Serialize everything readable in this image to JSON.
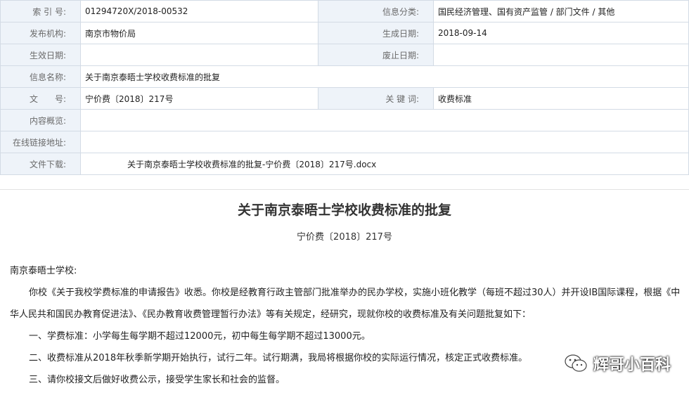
{
  "meta": {
    "index_label": "索 引 号:",
    "index_value": "01294720X/2018-00532",
    "category_label": "信息分类:",
    "category_value": "国民经济管理、国有资产监管 / 部门文件 / 其他",
    "publisher_label": "发布机构:",
    "publisher_value": "南京市物价局",
    "created_label": "生成日期:",
    "created_value": "2018-09-14",
    "effective_label": "生效日期:",
    "effective_value": "",
    "abolished_label": "废止日期:",
    "abolished_value": "",
    "name_label": "信息名称:",
    "name_value": "关于南京泰晤士学校收费标准的批复",
    "docno_label": "文　　号:",
    "docno_value": "宁价费〔2018〕217号",
    "keywords_label": "关 键 词:",
    "keywords_value": "收费标准",
    "summary_label": "内容概览:",
    "summary_value": "",
    "link_label": "在线链接地址:",
    "link_value": "",
    "download_label": "文件下载:",
    "download_value": "关于南京泰晤士学校收费标准的批复-宁价费〔2018〕217号.docx"
  },
  "document": {
    "title": "关于南京泰晤士学校收费标准的批复",
    "number": "宁价费〔2018〕217号",
    "salutation": "南京泰晤士学校:",
    "paragraph1": "你校《关于我校学费标准的申请报告》收悉。你校是经教育行政主管部门批准举办的民办学校，实施小班化教学（每班不超过30人）并开设IB国际课程，根据《中华人民共和国民办教育促进法》、《民办教育收费管理暂行办法》等有关规定，经研究，现就你校的收费标准及有关问题批复如下：",
    "item1": "一、学费标准：小学每生每学期不超过12000元，初中每生每学期不超过13000元。",
    "item2": "二、收费标准从2018年秋季新学期开始执行，试行二年。试行期满，我局将根据你校的实际运行情况，核定正式收费标准。",
    "item3": "三、请你校接文后做好收费公示，接受学生家长和社会的监督。"
  },
  "watermark": {
    "text": "辉哥小百科",
    "icon": "wechat-icon"
  }
}
